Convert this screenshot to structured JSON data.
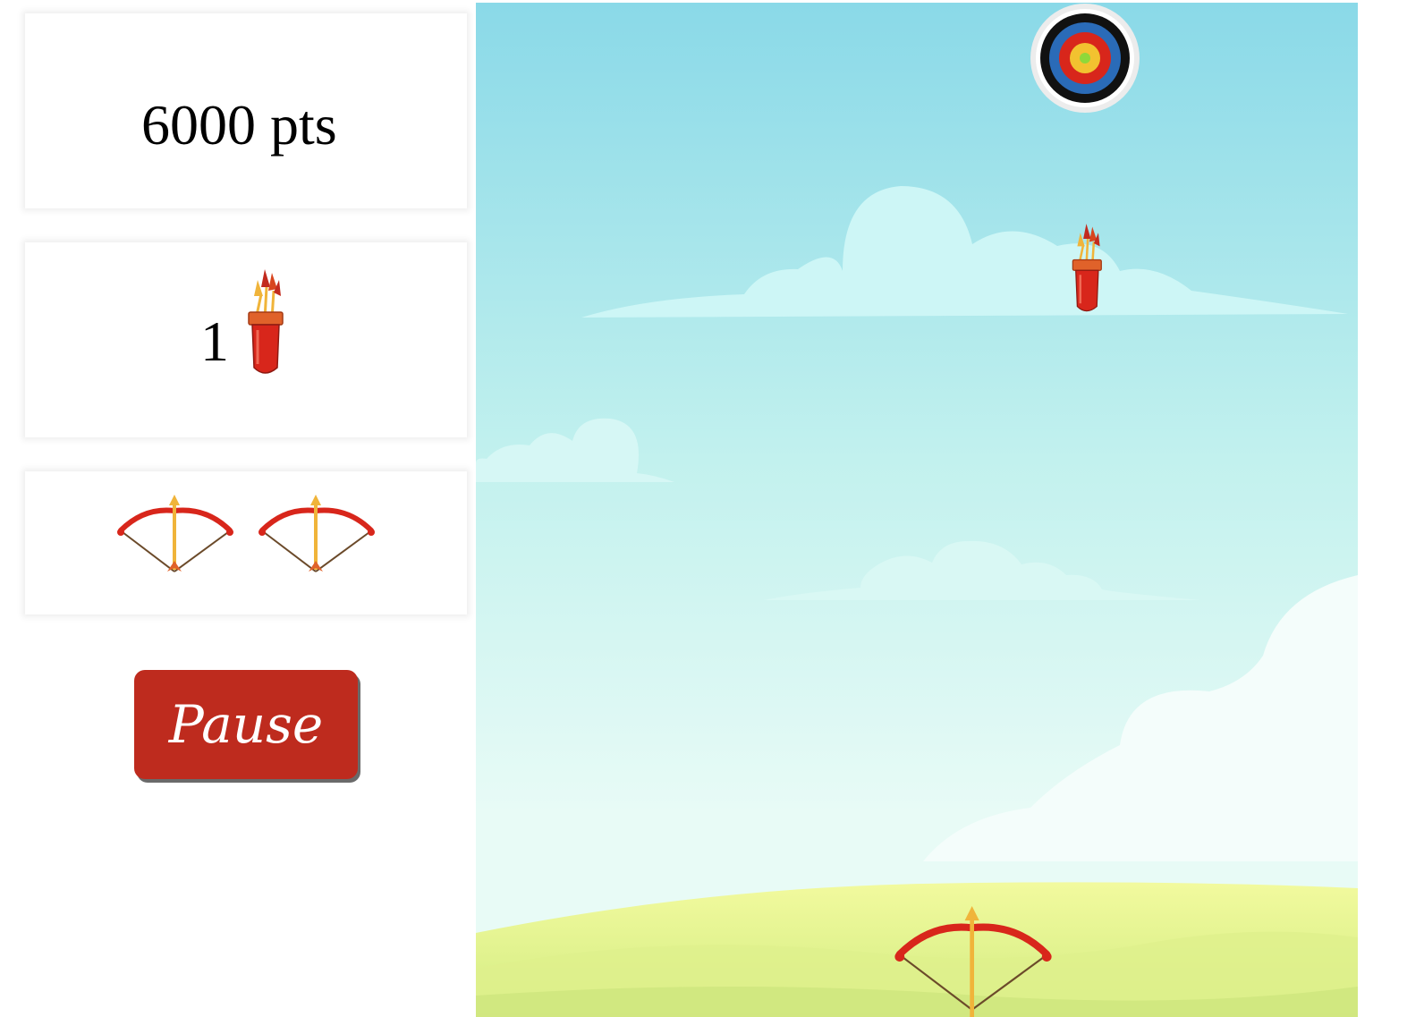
{
  "score": {
    "value": "6000",
    "unit": "pts"
  },
  "quiver": {
    "count": "1",
    "icon": "quiver-icon"
  },
  "lives": {
    "count": 2,
    "icon": "bow-icon"
  },
  "pause_button": {
    "label": "Pause"
  },
  "game": {
    "target_icon": "archery-target-icon",
    "falling_item_icon": "quiver-icon",
    "player_icon": "bow-icon"
  },
  "colors": {
    "pause": "#be2b1e",
    "sky_top": "#8ad9e8",
    "sky_bottom": "#e8fbf6",
    "grass": "#e9f59a",
    "bow_red": "#d8261b",
    "arrow_gold": "#f0b43a"
  }
}
